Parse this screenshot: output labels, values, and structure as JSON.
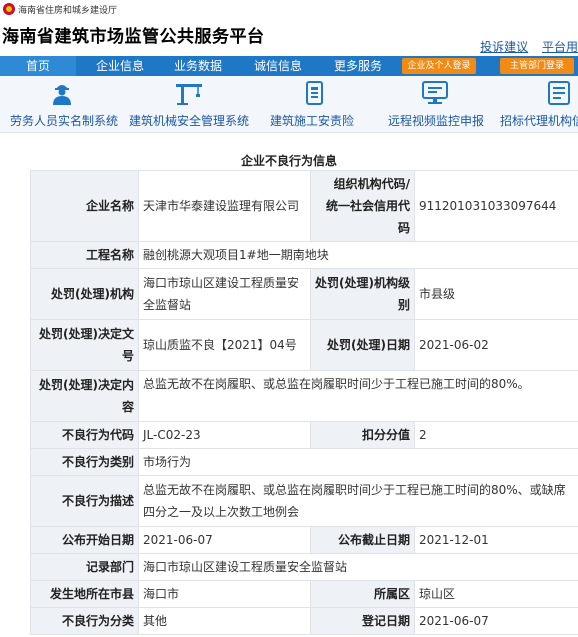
{
  "header": {
    "department": "海南省住房和城乡建设厅",
    "site_title": "海南省建筑市场监管公共服务平台",
    "links": [
      "投诉建议",
      "平台用"
    ]
  },
  "nav": {
    "items": [
      "首页",
      "企业信息",
      "业务数据",
      "诚信信息",
      "更多服务"
    ],
    "buttons": [
      "企业及个人登录",
      "主管部门登录"
    ]
  },
  "quick_links": [
    {
      "label": "劳务人员实名制系统",
      "icon": "worker-icon"
    },
    {
      "label": "建筑机械安全管理系统",
      "icon": "crane-icon"
    },
    {
      "label": "建筑施工安责险",
      "icon": "insurance-document-icon"
    },
    {
      "label": "远程视频监控申报",
      "icon": "monitor-icon"
    },
    {
      "label": "招标代理机构信",
      "icon": "agency-document-icon"
    }
  ],
  "section_title": "企业不良行为信息",
  "record": {
    "company_name_label": "企业名称",
    "company_name": "天津市华泰建设监理有限公司",
    "org_code_label_1": "组织机构代码/",
    "org_code_label_2": "统一社会信用代码",
    "org_code": "911201031033097644",
    "project_label": "工程名称",
    "project": "融创桃源大观项目1#地一期南地块",
    "authority_label": "处罚(处理)机构",
    "authority": "海口市琼山区建设工程质量安全监督站",
    "level_label": "处罚(处理)机构级别",
    "level": "市县级",
    "decision_no_label": "处罚(处理)决定文号",
    "decision_no": "琼山质监不良【2021】04号",
    "decision_date_label": "处罚(处理)日期",
    "decision_date": "2021-06-02",
    "decision_content_label": "处罚(处理)决定内容",
    "decision_content": "总监无故不在岗履职、或总监在岗履职时间少于工程已施工时间的80%。",
    "behavior_code_label": "不良行为代码",
    "behavior_code": "JL-C02-23",
    "points_label": "扣分分值",
    "points": "2",
    "category_label": "不良行为类别",
    "category": "市场行为",
    "description_label": "不良行为描述",
    "description": "总监无故不在岗履职、或总监在岗履职时间少于工程已施工时间的80%、或缺席四分之一及以上次数工地例会",
    "publish_start_label": "公布开始日期",
    "publish_start": "2021-06-07",
    "publish_end_label": "公布截止日期",
    "publish_end": "2021-12-01",
    "record_dept_label": "记录部门",
    "record_dept": "海口市琼山区建设工程质量安全监督站",
    "city_label": "发生地所在市县",
    "city": "海口市",
    "district_label": "所属区",
    "district": "琼山区",
    "class_label": "不良行为分类",
    "class": "其他",
    "register_date_label": "登记日期",
    "register_date": "2021-06-07"
  }
}
